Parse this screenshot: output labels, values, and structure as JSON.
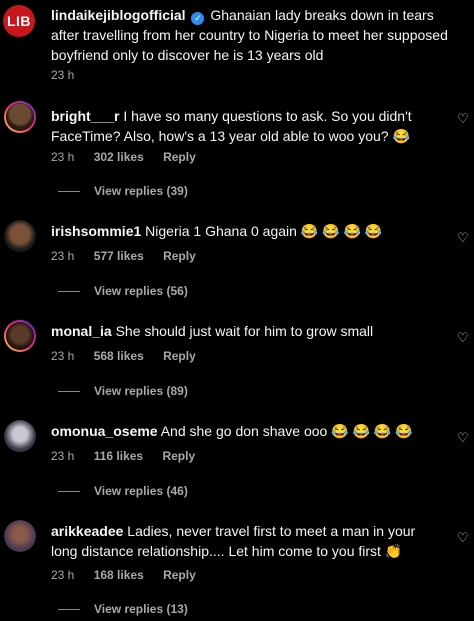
{
  "post": {
    "avatar_text": "LIB",
    "username": "lindaikejiblogofficial",
    "caption": "Ghanaian lady breaks down in tears after travelling from her country to Nigeria to meet her supposed boyfriend only to discover he is 13 years old",
    "time": "23 h"
  },
  "comments": [
    {
      "username": "bright___r",
      "text": "I have so many questions to ask. So you didn't FaceTime? Also, how's a 13 year old able to woo you?",
      "emoji": "😂",
      "time": "23 h",
      "likes": "302 likes",
      "reply": "Reply",
      "view_replies": "View replies (39)"
    },
    {
      "username": "irishsommie1",
      "text": "Nigeria 1 Ghana 0 again",
      "emoji": "😂 😂 😂 😂",
      "time": "23 h",
      "likes": "577 likes",
      "reply": "Reply",
      "view_replies": "View replies (56)"
    },
    {
      "username": "monal_ia",
      "text": "She should just wait for him to grow small",
      "emoji": "",
      "time": "23 h",
      "likes": "568 likes",
      "reply": "Reply",
      "view_replies": "View replies (89)"
    },
    {
      "username": "omonua_oseme",
      "text": "And she go don shave ooo",
      "emoji": "😂 😂 😂 😂",
      "time": "23 h",
      "likes": "116 likes",
      "reply": "Reply",
      "view_replies": "View replies (46)"
    },
    {
      "username": "arikkeadee",
      "text": "Ladies, never travel first to meet a man in your long distance relationship.... Let him come to you first",
      "emoji": "👏",
      "time": "23 h",
      "likes": "168 likes",
      "reply": "Reply",
      "view_replies": "View replies (13)"
    }
  ],
  "icons": {
    "like": "heart-outline-icon",
    "verified": "verified-badge-icon"
  },
  "colors": {
    "background": "#000000",
    "text": "#f5f5f5",
    "muted": "#a8a8a8",
    "verified": "#2f8df0",
    "logo": "#c8161d"
  }
}
